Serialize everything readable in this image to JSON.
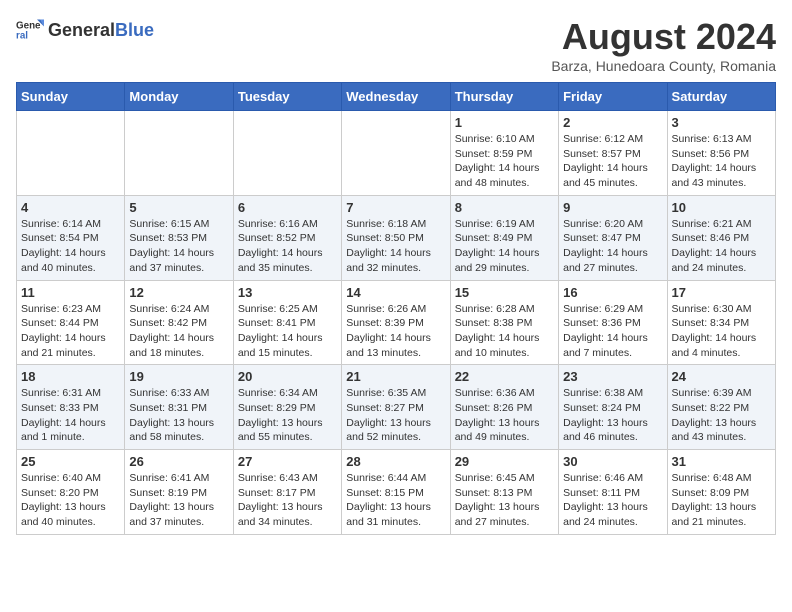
{
  "logo": {
    "text_general": "General",
    "text_blue": "Blue"
  },
  "title": "August 2024",
  "subtitle": "Barza, Hunedoara County, Romania",
  "days_of_week": [
    "Sunday",
    "Monday",
    "Tuesday",
    "Wednesday",
    "Thursday",
    "Friday",
    "Saturday"
  ],
  "weeks": [
    [
      {
        "day": "",
        "info": ""
      },
      {
        "day": "",
        "info": ""
      },
      {
        "day": "",
        "info": ""
      },
      {
        "day": "",
        "info": ""
      },
      {
        "day": "1",
        "info": "Sunrise: 6:10 AM\nSunset: 8:59 PM\nDaylight: 14 hours and 48 minutes."
      },
      {
        "day": "2",
        "info": "Sunrise: 6:12 AM\nSunset: 8:57 PM\nDaylight: 14 hours and 45 minutes."
      },
      {
        "day": "3",
        "info": "Sunrise: 6:13 AM\nSunset: 8:56 PM\nDaylight: 14 hours and 43 minutes."
      }
    ],
    [
      {
        "day": "4",
        "info": "Sunrise: 6:14 AM\nSunset: 8:54 PM\nDaylight: 14 hours and 40 minutes."
      },
      {
        "day": "5",
        "info": "Sunrise: 6:15 AM\nSunset: 8:53 PM\nDaylight: 14 hours and 37 minutes."
      },
      {
        "day": "6",
        "info": "Sunrise: 6:16 AM\nSunset: 8:52 PM\nDaylight: 14 hours and 35 minutes."
      },
      {
        "day": "7",
        "info": "Sunrise: 6:18 AM\nSunset: 8:50 PM\nDaylight: 14 hours and 32 minutes."
      },
      {
        "day": "8",
        "info": "Sunrise: 6:19 AM\nSunset: 8:49 PM\nDaylight: 14 hours and 29 minutes."
      },
      {
        "day": "9",
        "info": "Sunrise: 6:20 AM\nSunset: 8:47 PM\nDaylight: 14 hours and 27 minutes."
      },
      {
        "day": "10",
        "info": "Sunrise: 6:21 AM\nSunset: 8:46 PM\nDaylight: 14 hours and 24 minutes."
      }
    ],
    [
      {
        "day": "11",
        "info": "Sunrise: 6:23 AM\nSunset: 8:44 PM\nDaylight: 14 hours and 21 minutes."
      },
      {
        "day": "12",
        "info": "Sunrise: 6:24 AM\nSunset: 8:42 PM\nDaylight: 14 hours and 18 minutes."
      },
      {
        "day": "13",
        "info": "Sunrise: 6:25 AM\nSunset: 8:41 PM\nDaylight: 14 hours and 15 minutes."
      },
      {
        "day": "14",
        "info": "Sunrise: 6:26 AM\nSunset: 8:39 PM\nDaylight: 14 hours and 13 minutes."
      },
      {
        "day": "15",
        "info": "Sunrise: 6:28 AM\nSunset: 8:38 PM\nDaylight: 14 hours and 10 minutes."
      },
      {
        "day": "16",
        "info": "Sunrise: 6:29 AM\nSunset: 8:36 PM\nDaylight: 14 hours and 7 minutes."
      },
      {
        "day": "17",
        "info": "Sunrise: 6:30 AM\nSunset: 8:34 PM\nDaylight: 14 hours and 4 minutes."
      }
    ],
    [
      {
        "day": "18",
        "info": "Sunrise: 6:31 AM\nSunset: 8:33 PM\nDaylight: 14 hours and 1 minute."
      },
      {
        "day": "19",
        "info": "Sunrise: 6:33 AM\nSunset: 8:31 PM\nDaylight: 13 hours and 58 minutes."
      },
      {
        "day": "20",
        "info": "Sunrise: 6:34 AM\nSunset: 8:29 PM\nDaylight: 13 hours and 55 minutes."
      },
      {
        "day": "21",
        "info": "Sunrise: 6:35 AM\nSunset: 8:27 PM\nDaylight: 13 hours and 52 minutes."
      },
      {
        "day": "22",
        "info": "Sunrise: 6:36 AM\nSunset: 8:26 PM\nDaylight: 13 hours and 49 minutes."
      },
      {
        "day": "23",
        "info": "Sunrise: 6:38 AM\nSunset: 8:24 PM\nDaylight: 13 hours and 46 minutes."
      },
      {
        "day": "24",
        "info": "Sunrise: 6:39 AM\nSunset: 8:22 PM\nDaylight: 13 hours and 43 minutes."
      }
    ],
    [
      {
        "day": "25",
        "info": "Sunrise: 6:40 AM\nSunset: 8:20 PM\nDaylight: 13 hours and 40 minutes."
      },
      {
        "day": "26",
        "info": "Sunrise: 6:41 AM\nSunset: 8:19 PM\nDaylight: 13 hours and 37 minutes."
      },
      {
        "day": "27",
        "info": "Sunrise: 6:43 AM\nSunset: 8:17 PM\nDaylight: 13 hours and 34 minutes."
      },
      {
        "day": "28",
        "info": "Sunrise: 6:44 AM\nSunset: 8:15 PM\nDaylight: 13 hours and 31 minutes."
      },
      {
        "day": "29",
        "info": "Sunrise: 6:45 AM\nSunset: 8:13 PM\nDaylight: 13 hours and 27 minutes."
      },
      {
        "day": "30",
        "info": "Sunrise: 6:46 AM\nSunset: 8:11 PM\nDaylight: 13 hours and 24 minutes."
      },
      {
        "day": "31",
        "info": "Sunrise: 6:48 AM\nSunset: 8:09 PM\nDaylight: 13 hours and 21 minutes."
      }
    ]
  ]
}
